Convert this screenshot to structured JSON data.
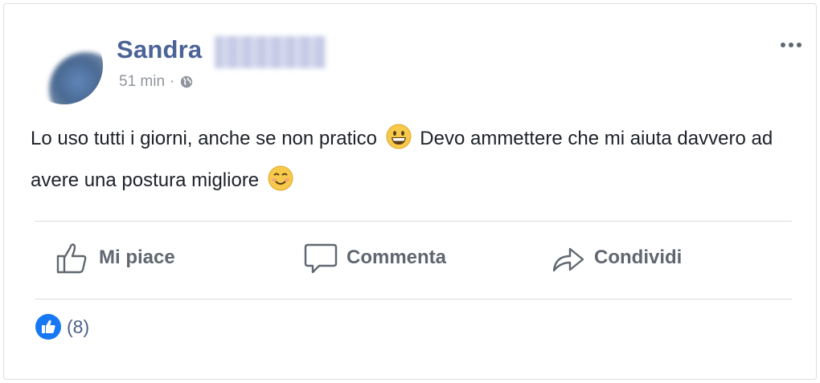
{
  "post": {
    "author_name": "Sandra",
    "timestamp": "51 min",
    "separator": "·",
    "audience_icon": "globe-icon",
    "text_part1": "Lo uso tutti i giorni, anche se non pratico",
    "emoji1": "grinning-face-emoji",
    "text_part2": "Devo ammettere che mi aiuta davvero ad avere una postura migliore",
    "emoji2": "smiling-face-emoji"
  },
  "actions": {
    "like_label": "Mi piace",
    "comment_label": "Commenta",
    "share_label": "Condividi"
  },
  "reactions": {
    "count_label": "(8)",
    "icon": "like-badge-icon"
  },
  "colors": {
    "author": "#4b6396",
    "action_text": "#606770",
    "meta_text": "#90949c",
    "like_badge": "#1877f2"
  }
}
